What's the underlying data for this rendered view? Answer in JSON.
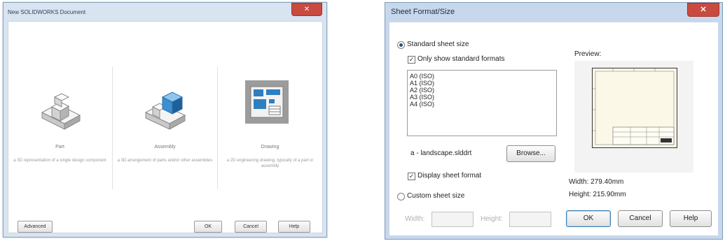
{
  "new_doc": {
    "title": "New SOLIDWORKS Document",
    "close": "✕",
    "templates": [
      {
        "name": "Part",
        "description": "a 3D representation of a single design component"
      },
      {
        "name": "Assembly",
        "description": "a 3D arrangement of parts and/or other assemblies"
      },
      {
        "name": "Drawing",
        "description": "a 2D engineering drawing, typically of a part or assembly"
      }
    ],
    "buttons": {
      "advanced": "Advanced",
      "ok": "OK",
      "cancel": "Cancel",
      "help": "Help"
    }
  },
  "sheet_format": {
    "title": "Sheet Format/Size",
    "close": "✕",
    "standard_label": "Standard sheet size",
    "only_standard_label": "Only show standard formats",
    "sizes": [
      "A0 (ISO)",
      "A1 (ISO)",
      "A2 (ISO)",
      "A3 (ISO)",
      "A4 (ISO)"
    ],
    "format_file": "a - landscape.slddrt",
    "browse": "Browse...",
    "display_format_label": "Display sheet format",
    "custom_label": "Custom sheet size",
    "width_label": "Width:",
    "height_label": "Height:",
    "preview_label": "Preview:",
    "width_value": "Width:  279.40mm",
    "height_value": "Height:  215.90mm",
    "buttons": {
      "ok": "OK",
      "cancel": "Cancel",
      "help": "Help"
    },
    "only_standard_checked": true,
    "display_format_checked": true,
    "selected_radio": "standard"
  },
  "colors": {
    "title_bar": "#d8e4f0",
    "close_button": "#c94a3f",
    "preview_paper": "#fbf8e8"
  }
}
